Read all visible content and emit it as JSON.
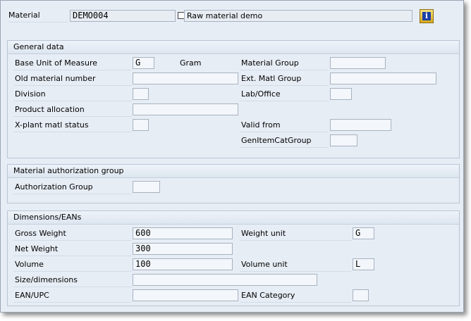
{
  "header": {
    "material_label": "Material",
    "material_value": "DEMO004",
    "description_value": "Raw material demo",
    "info_icon": "info-icon",
    "info_glyph": "i"
  },
  "general": {
    "title": "General data",
    "base_uom_label": "Base Unit of Measure",
    "base_uom_value": "G",
    "base_uom_text": "Gram",
    "material_group_label": "Material Group",
    "material_group_value": "",
    "old_material_label": "Old material number",
    "old_material_value": "",
    "ext_matl_group_label": "Ext. Matl Group",
    "ext_matl_group_value": "",
    "division_label": "Division",
    "division_value": "",
    "lab_office_label": "Lab/Office",
    "lab_office_value": "",
    "product_alloc_label": "Product allocation",
    "product_alloc_value": "",
    "xplant_label": "X-plant matl status",
    "xplant_value": "",
    "valid_from_label": "Valid from",
    "valid_from_value": "",
    "genitem_label": "GenItemCatGroup",
    "genitem_value": ""
  },
  "auth": {
    "title": "Material authorization group",
    "auth_group_label": "Authorization Group",
    "auth_group_value": ""
  },
  "dims": {
    "title": "Dimensions/EANs",
    "gross_label": "Gross Weight",
    "gross_value": "600",
    "weight_unit_label": "Weight unit",
    "weight_unit_value": "G",
    "net_label": "Net Weight",
    "net_value": "300",
    "volume_label": "Volume",
    "volume_value": "100",
    "volume_unit_label": "Volume unit",
    "volume_unit_value": "L",
    "size_label": "Size/dimensions",
    "size_value": "",
    "ean_label": "EAN/UPC",
    "ean_value": "",
    "ean_cat_label": "EAN Category",
    "ean_cat_value": ""
  }
}
